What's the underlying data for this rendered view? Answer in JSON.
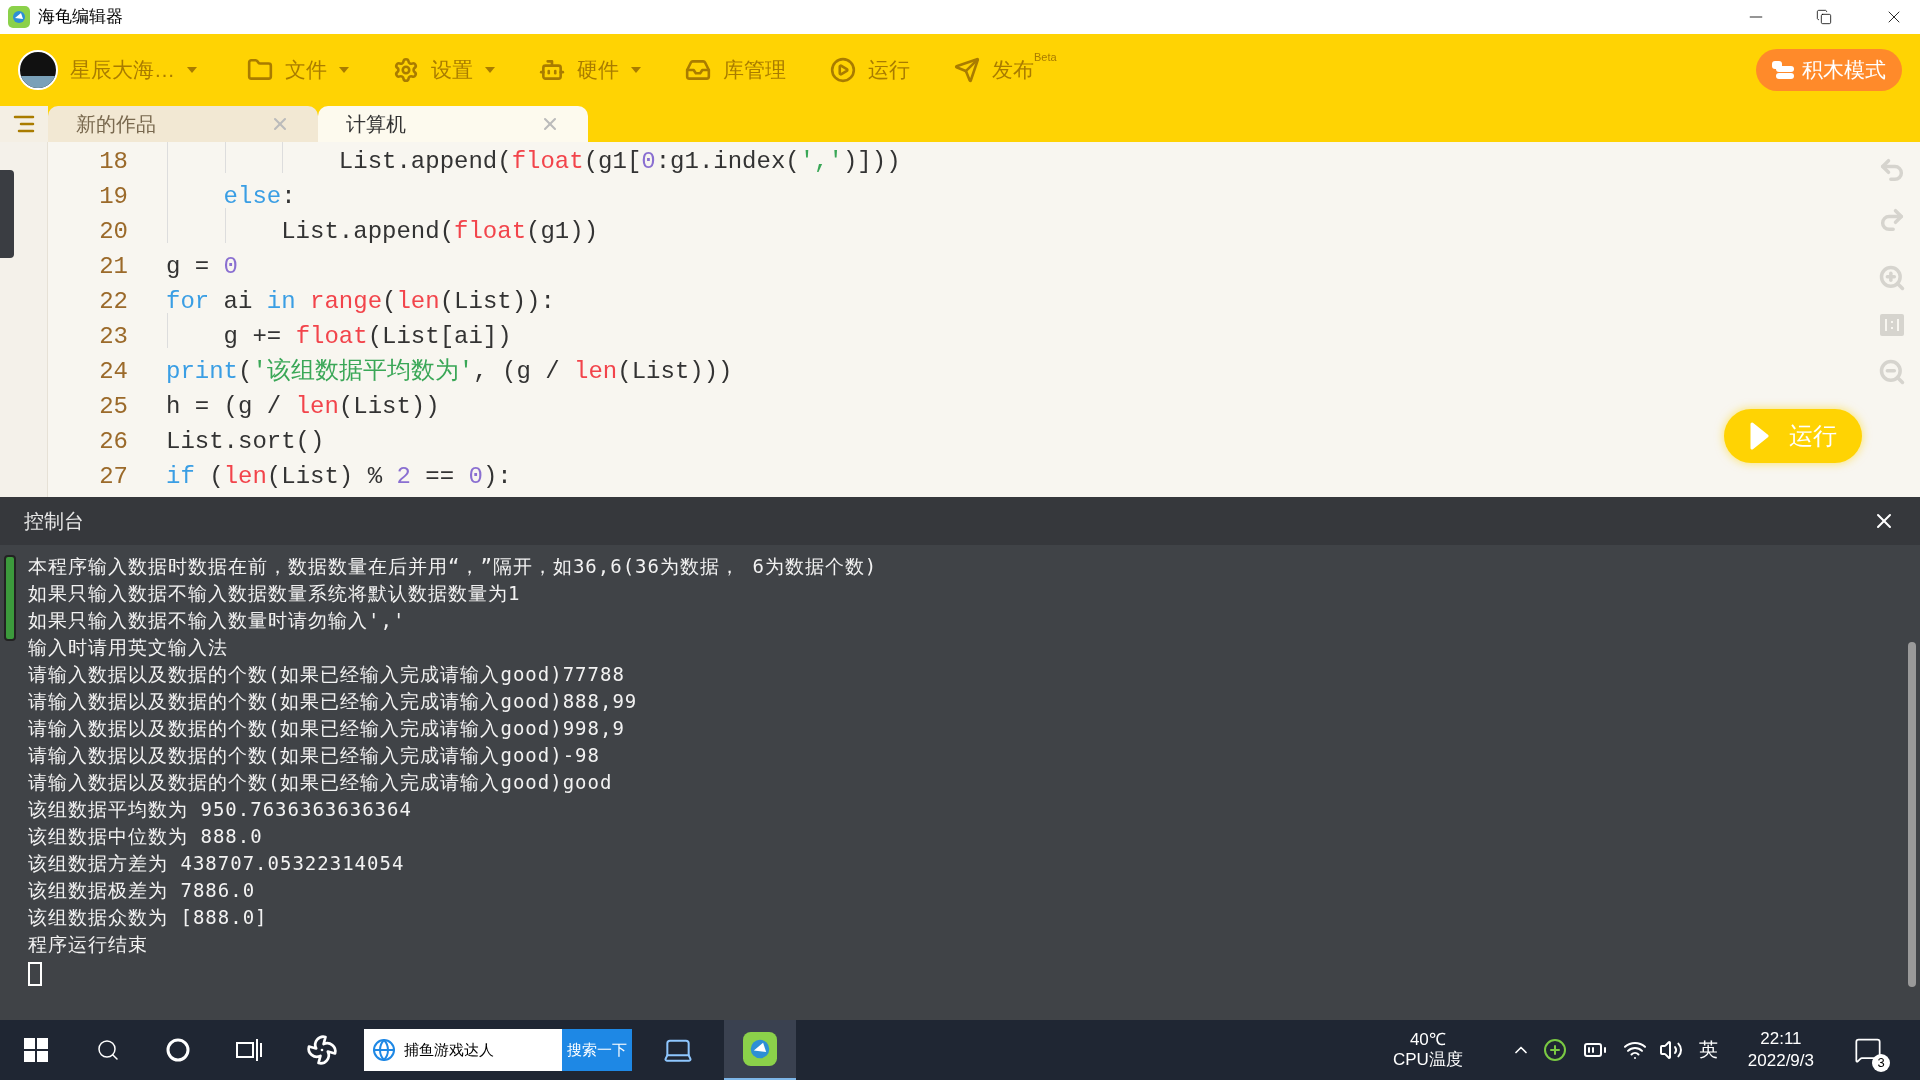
{
  "window": {
    "title": "海龟编辑器"
  },
  "toolbar": {
    "user": {
      "name": "星辰大海…",
      "dropdown": true
    },
    "items": [
      {
        "label": "文件",
        "dropdown": true
      },
      {
        "label": "设置",
        "dropdown": true
      },
      {
        "label": "硬件",
        "dropdown": true
      },
      {
        "label": "库管理",
        "dropdown": false
      },
      {
        "label": "运行",
        "dropdown": false
      },
      {
        "label": "发布",
        "badge": "Beta",
        "dropdown": false
      }
    ],
    "mode_button": "积木模式"
  },
  "tabs": [
    {
      "label": "新的作品",
      "selected": false
    },
    {
      "label": "计算机",
      "selected": true
    }
  ],
  "editor": {
    "lines": [
      {
        "number": "18",
        "tokens": [
          {
            "kind": "plain",
            "text": "            List.append("
          },
          {
            "kind": "builtin",
            "text": "float"
          },
          {
            "kind": "plain",
            "text": "(g1["
          },
          {
            "kind": "number",
            "text": "0"
          },
          {
            "kind": "plain",
            "text": ":g1.index("
          },
          {
            "kind": "string",
            "text": "','"
          },
          {
            "kind": "plain",
            "text": ")]))"
          }
        ]
      },
      {
        "number": "19",
        "tokens": [
          {
            "kind": "keyword",
            "text": "    else"
          },
          {
            "kind": "plain",
            "text": ":"
          }
        ]
      },
      {
        "number": "20",
        "tokens": [
          {
            "kind": "plain",
            "text": "        List.append("
          },
          {
            "kind": "builtin",
            "text": "float"
          },
          {
            "kind": "plain",
            "text": "(g1))"
          }
        ]
      },
      {
        "number": "21",
        "tokens": [
          {
            "kind": "plain",
            "text": "g = "
          },
          {
            "kind": "number",
            "text": "0"
          }
        ]
      },
      {
        "number": "22",
        "tokens": [
          {
            "kind": "keyword",
            "text": "for"
          },
          {
            "kind": "plain",
            "text": " ai "
          },
          {
            "kind": "keyword",
            "text": "in "
          },
          {
            "kind": "builtin",
            "text": "range"
          },
          {
            "kind": "plain",
            "text": "("
          },
          {
            "kind": "builtin",
            "text": "len"
          },
          {
            "kind": "plain",
            "text": "(List)):"
          }
        ]
      },
      {
        "number": "23",
        "tokens": [
          {
            "kind": "plain",
            "text": "    g += "
          },
          {
            "kind": "builtin",
            "text": "float"
          },
          {
            "kind": "plain",
            "text": "(List[ai])"
          }
        ]
      },
      {
        "number": "24",
        "tokens": [
          {
            "kind": "keyword",
            "text": "print"
          },
          {
            "kind": "plain",
            "text": "("
          },
          {
            "kind": "string",
            "text": "'该组数据平均数为'"
          },
          {
            "kind": "plain",
            "text": ", (g / "
          },
          {
            "kind": "builtin",
            "text": "len"
          },
          {
            "kind": "plain",
            "text": "(List)))"
          }
        ]
      },
      {
        "number": "25",
        "tokens": [
          {
            "kind": "plain",
            "text": "h = (g / "
          },
          {
            "kind": "builtin",
            "text": "len"
          },
          {
            "kind": "plain",
            "text": "(List))"
          }
        ]
      },
      {
        "number": "26",
        "tokens": [
          {
            "kind": "plain",
            "text": "List.sort()"
          }
        ]
      },
      {
        "number": "27",
        "tokens": [
          {
            "kind": "keyword",
            "text": "if"
          },
          {
            "kind": "plain",
            "text": " ("
          },
          {
            "kind": "builtin",
            "text": "len"
          },
          {
            "kind": "plain",
            "text": "(List) % "
          },
          {
            "kind": "number",
            "text": "2"
          },
          {
            "kind": "plain",
            "text": " == "
          },
          {
            "kind": "number",
            "text": "0"
          },
          {
            "kind": "plain",
            "text": "):"
          }
        ]
      }
    ],
    "run_button": "运行"
  },
  "console": {
    "title": "控制台",
    "lines": [
      "本程序输入数据时数据在前，数据数量在后并用“，”隔开，如36,6(36为数据， 6为数据个数)",
      "如果只输入数据不输入数据数量系统将默认数据数量为1",
      "如果只输入数据不输入数量时请勿输入','",
      "输入时请用英文输入法",
      "请输入数据以及数据的个数(如果已经输入完成请输入good)77788",
      "请输入数据以及数据的个数(如果已经输入完成请输入good)888,99",
      "请输入数据以及数据的个数(如果已经输入完成请输入good)998,9",
      "请输入数据以及数据的个数(如果已经输入完成请输入good)-98",
      "请输入数据以及数据的个数(如果已经输入完成请输入good)good",
      "该组数据平均数为 950.7636363636364",
      "该组数据中位数为 888.0",
      "该组数据方差为 438707.05322314054",
      "该组数据极差为 7886.0",
      "该组数据众数为 [888.0]",
      "程序运行结束"
    ]
  },
  "taskbar": {
    "search_text": "捕鱼游戏达人",
    "search_button": "搜索一下",
    "temperature": "40℃",
    "temperature_label": "CPU温度",
    "ime": "英",
    "time": "22:11",
    "date": "2022/9/3",
    "notifications": "3"
  }
}
